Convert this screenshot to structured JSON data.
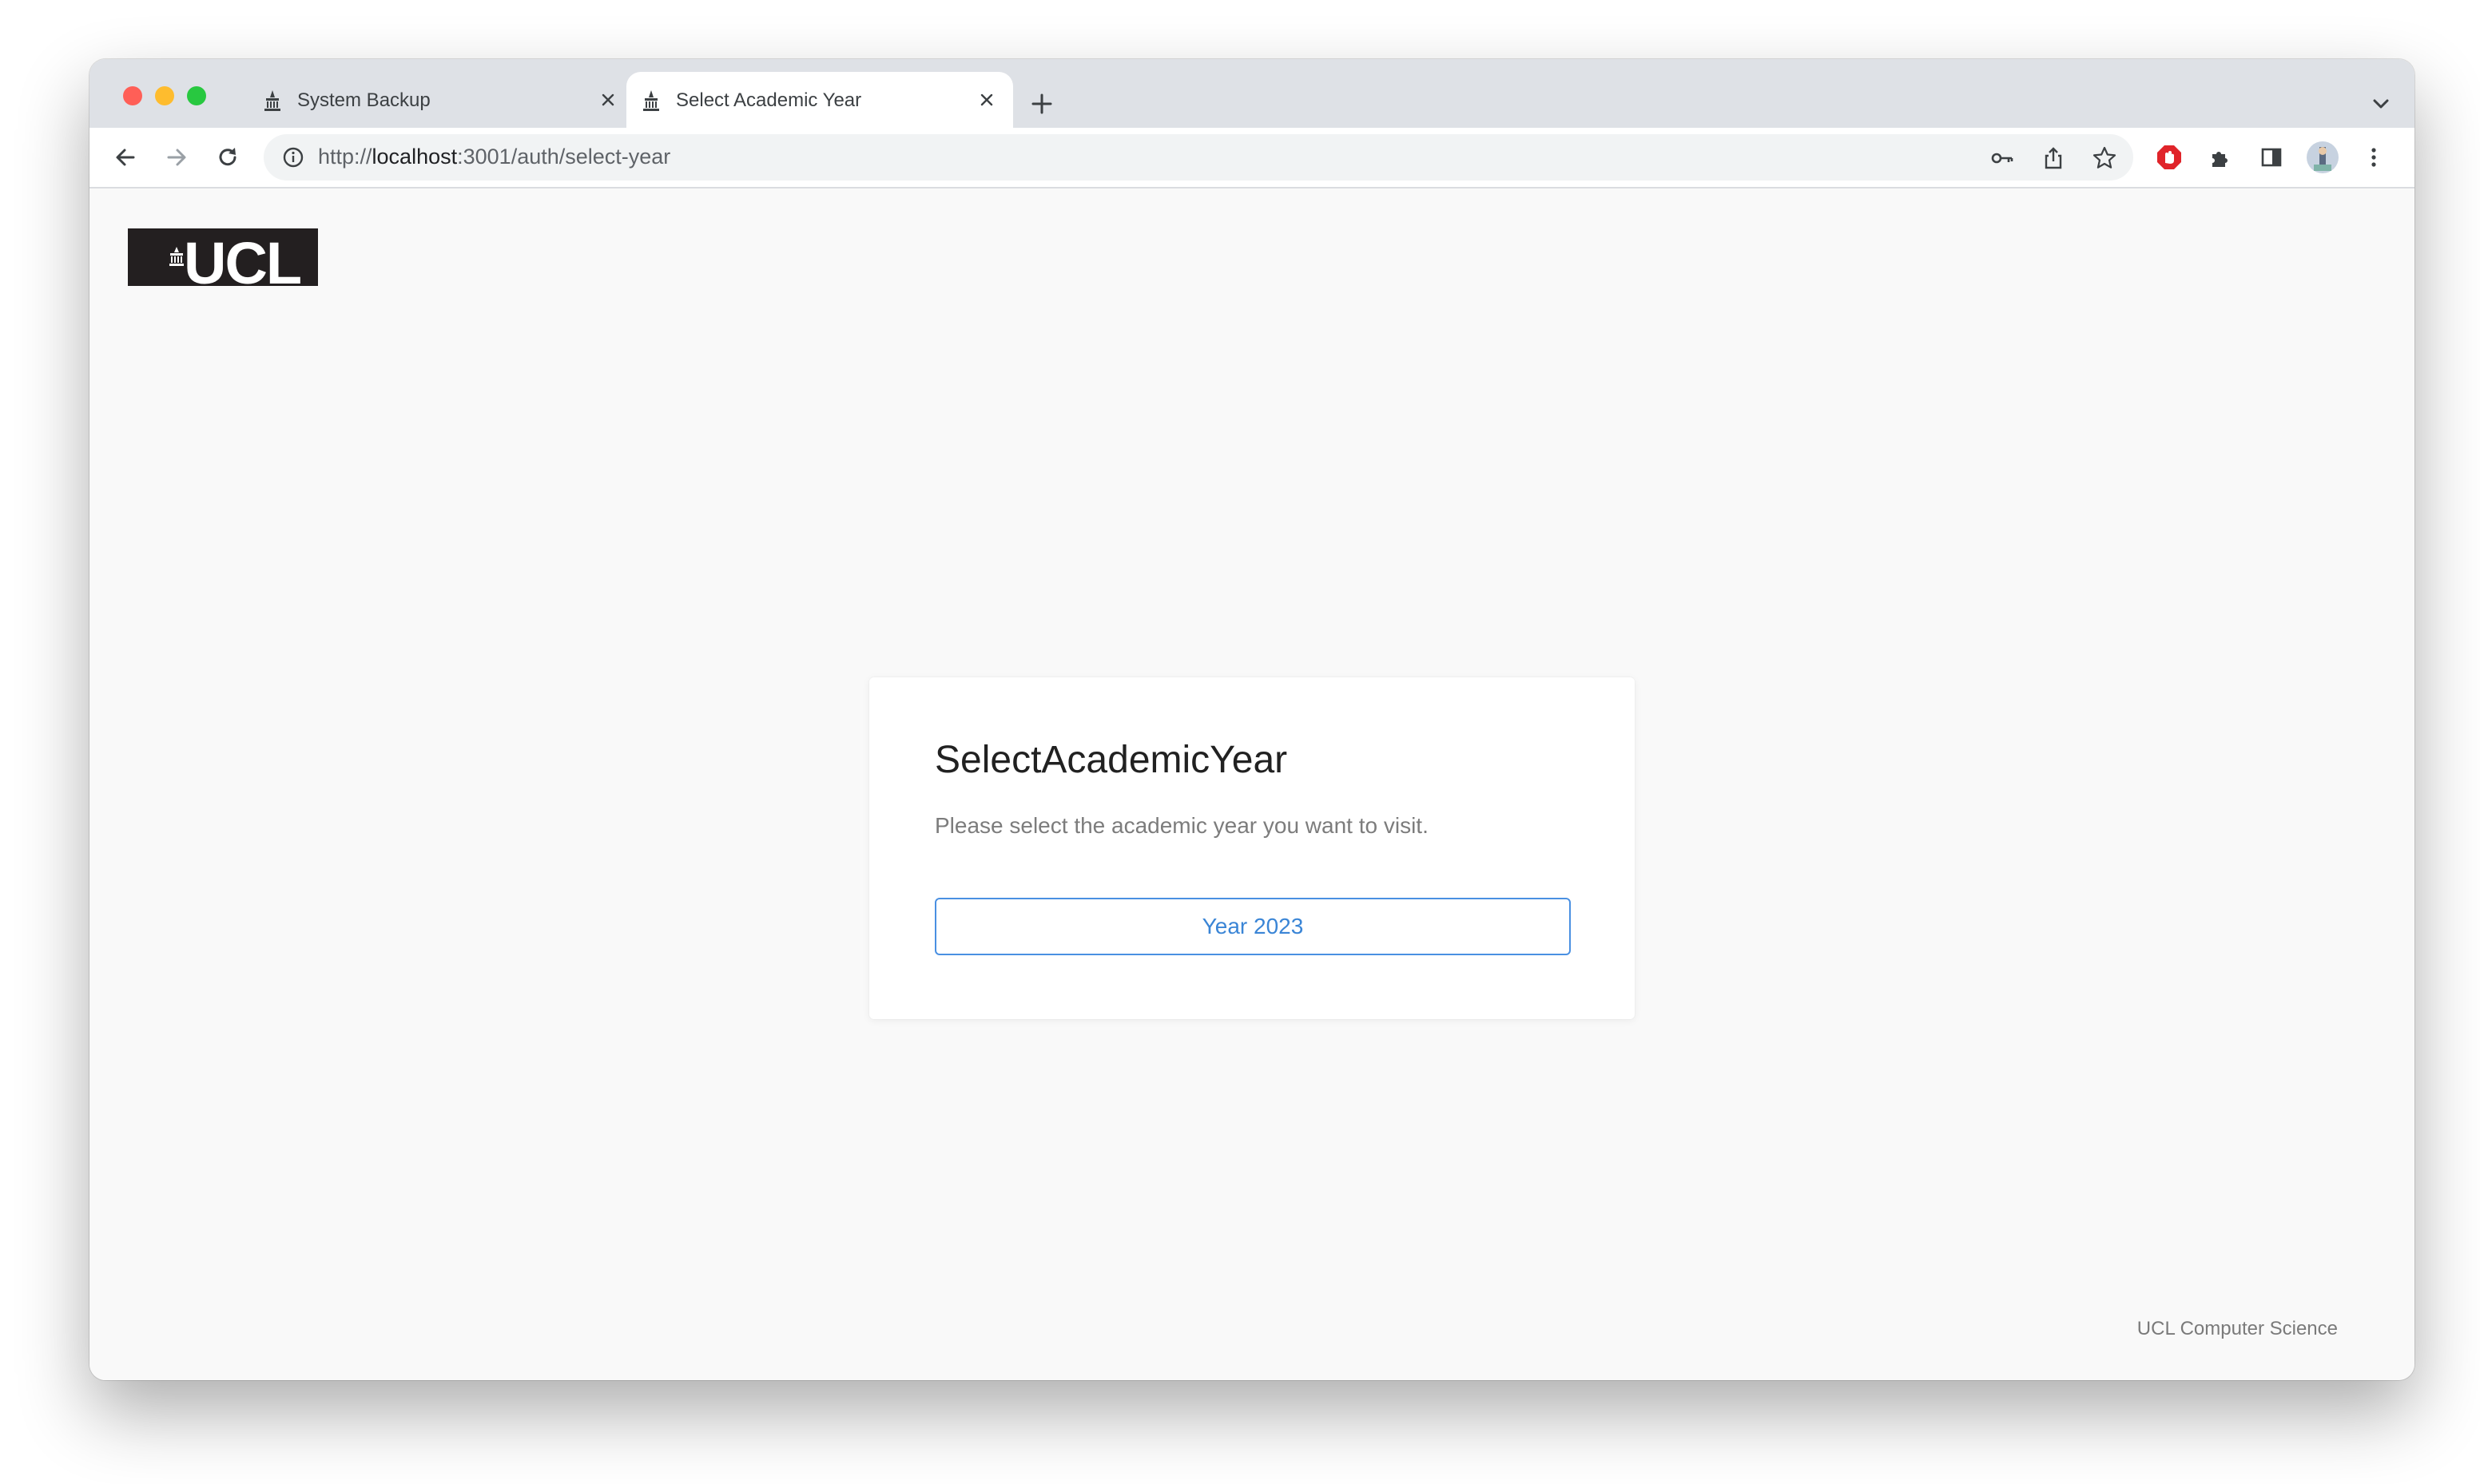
{
  "browser": {
    "tabs": [
      {
        "title": "System Backup",
        "active": false
      },
      {
        "title": "Select Academic Year",
        "active": true
      }
    ],
    "url": {
      "scheme": "http://",
      "host": "localhost",
      "rest": ":3001/auth/select-year"
    }
  },
  "page": {
    "logo_text": "UCL",
    "card": {
      "title": "SelectAcademicYear",
      "subtitle": "Please select the academic year you want to visit.",
      "year_button": "Year 2023"
    },
    "footer": "UCL Computer Science"
  },
  "colors": {
    "accent": "#4a90e2",
    "logo_bg": "#231f20",
    "page_bg": "#f9f9f9"
  }
}
